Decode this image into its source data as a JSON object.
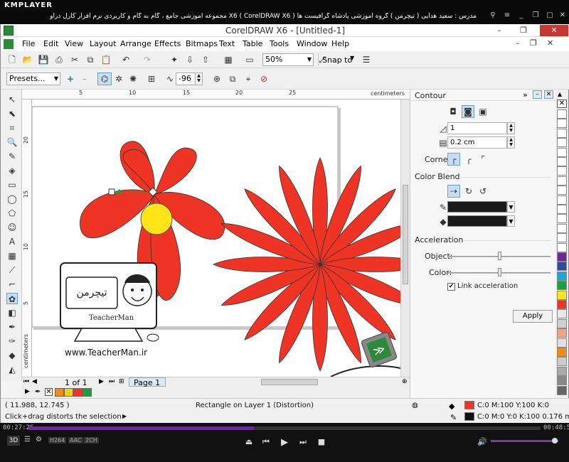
{
  "player": {
    "logo": "KMPLAYER",
    "title": "مجموعه آموزشی جامع ، گام به گام و کاربردی نرم افزار کارل دراو X6 ( CorelDRAW X6 ) مدرس : سعید هدایی ( تیچرمن ) گروه آموزشی پادشاه گرافیست ها",
    "time_elapsed": "00:27:26",
    "time_total": "00:48:56",
    "progress_fraction": 0.44,
    "badges": [
      "H264",
      "AAC",
      "2CH"
    ],
    "mode_3d": "3D"
  },
  "app": {
    "title": "CorelDRAW X6 - [Untitled-1]"
  },
  "menu": [
    "File",
    "Edit",
    "View",
    "Layout",
    "Arrange",
    "Effects",
    "Bitmaps",
    "Text",
    "Table",
    "Tools",
    "Window",
    "Help"
  ],
  "toolbar": {
    "zoom": "50%",
    "snap_to": "Snap to",
    "presets": "Presets...",
    "rotation_value": "-96"
  },
  "ruler": {
    "top_labels": [
      "5",
      "10",
      "15",
      "20",
      "25"
    ],
    "left_labels": [
      "20",
      "15",
      "10",
      "5"
    ],
    "unit": "centimeters"
  },
  "page_nav": {
    "counter": "1 of 1",
    "page_tab": "Page 1"
  },
  "docker": {
    "title": "Contour",
    "steps_value": "1",
    "offset_value": "0.2 cm",
    "corner_label": "Corner:",
    "color_blend_label": "Color Blend",
    "acceleration_label": "Acceleration",
    "object_label": "Object:",
    "color_label": "Color:",
    "link_acceleration_label": "Link acceleration",
    "link_acceleration_checked": true,
    "apply_label": "Apply",
    "object_slider": 0.5,
    "color_slider": 0.5
  },
  "watermark": {
    "url": "www.TeacherMan.ir",
    "brand": "TeacherMan"
  },
  "status": {
    "coords": "( 11.988, 12.745 )",
    "object_info": "Rectangle on Layer 1  (Distortion)",
    "hint": "Click+drag distorts the selection",
    "fill_info": "C:0 M:100 Y:100 K:0",
    "outline_info": "C:0 M:0 Y:0 K:100  0.176 mm"
  },
  "colors": {
    "flower_red": "#ee3424",
    "flower_center": "#ffe41a",
    "accent_purple": "#6a2c91"
  },
  "palette_bottom": [
    "#ee8c1a",
    "#f4d314",
    "#ee3424",
    "#1f9e3c"
  ],
  "palette_right": [
    "#ffffff",
    "#ffffff",
    "#ffffff",
    "#ffffff",
    "#ffffff",
    "#ffffff",
    "#ffffff",
    "#ffffff",
    "#ffffff",
    "#ffffff",
    "#ffffff",
    "#ffffff",
    "#ffffff",
    "#ffffff",
    "#ffffff",
    "#6c2a8e",
    "#2a4fa0",
    "#1ba6e0",
    "#1f9e3c",
    "#ffe41a",
    "#ee3424",
    "#e8e8e8",
    "#d0d0d0",
    "#f4a37a",
    "#e0e0e0",
    "#ee8c1a",
    "#cccccc",
    "#aaaaaa",
    "#888888",
    "#666666"
  ]
}
